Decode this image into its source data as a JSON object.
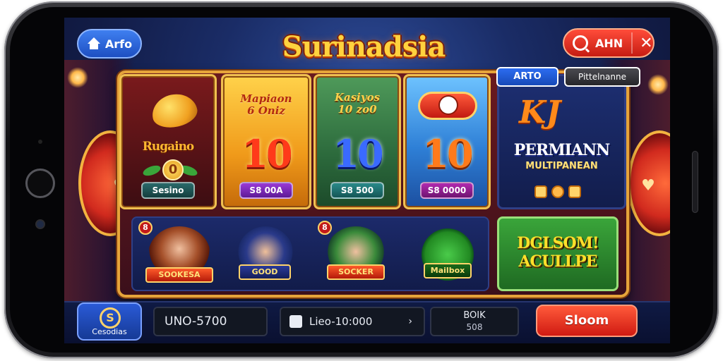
{
  "app": {
    "logo_text": "Surinadsia"
  },
  "top_bar": {
    "home_label": "Arfo",
    "account_label": "AHN",
    "close_symbol": "✕"
  },
  "tabs": [
    {
      "label": "ARTO"
    },
    {
      "label": "Pittelnanne"
    }
  ],
  "cards": [
    {
      "title": "Rugaino",
      "coin_value": "0",
      "chip": "Sesino"
    },
    {
      "title_line1": "Mapiaon",
      "title_line2": "6 Oniz",
      "big_number": "10",
      "chip": "S8 00A"
    },
    {
      "title_line1": "Kasiyos",
      "title_line2": "10 zo0",
      "big_number": "10",
      "chip": "S8 500"
    },
    {
      "big_number": "10",
      "chip": "S8 0000"
    },
    {
      "logo": "KJ",
      "title": "PERMIANN",
      "subtitle": "MULTIPANEAN"
    }
  ],
  "lower_row": [
    {
      "badge": "8",
      "banner": "SOOKESA"
    },
    {
      "banner": "GOOD"
    },
    {
      "badge": "8",
      "banner": "SOCKER"
    },
    {
      "banner": "Mailbox"
    }
  ],
  "lower_feature": {
    "title_line1": "DGLSOM!",
    "title_line2": "ACULLPE"
  },
  "bottom_bar": {
    "coins_label": "Cesodias",
    "coins_symbol": "S",
    "balance": "UNO-5700",
    "bet_range": "Lieo-10:000",
    "bet_arrow": "›",
    "bank_label": "BOIK",
    "bank_value": "508",
    "action_label": "Sloom"
  },
  "icons": [
    "home-icon",
    "search-icon",
    "close-icon",
    "gift-icon",
    "dice-icon",
    "coin-icon",
    "chevron-right-icon"
  ],
  "colors": {
    "accent_gold": "#f0c050",
    "action_red": "#d01a12",
    "primary_blue": "#1d4fc2"
  }
}
